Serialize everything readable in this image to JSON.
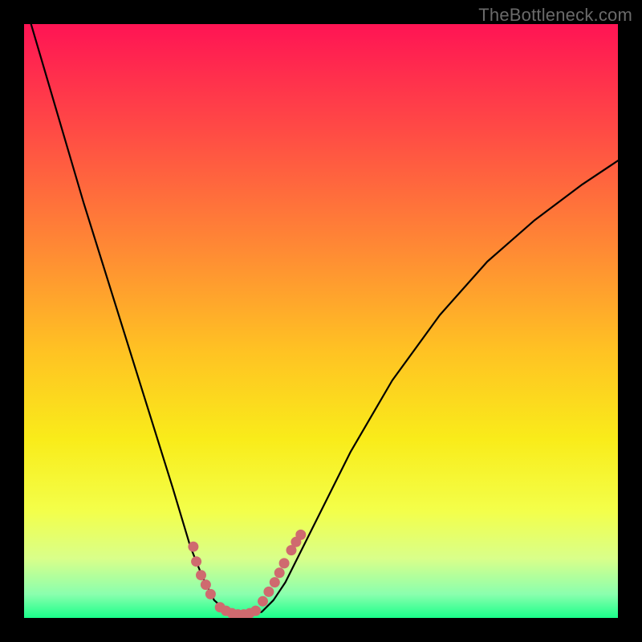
{
  "watermark": "TheBottleneck.com",
  "chart_data": {
    "type": "line",
    "title": "",
    "xlabel": "",
    "ylabel": "",
    "xlim": [
      0,
      100
    ],
    "ylim": [
      0,
      100
    ],
    "series": [
      {
        "name": "bottleneck-curve",
        "x": [
          0,
          5,
          10,
          15,
          20,
          25,
          28,
          30,
          32,
          34,
          36,
          38,
          40,
          42,
          44,
          48,
          55,
          62,
          70,
          78,
          86,
          94,
          100
        ],
        "y": [
          104,
          87,
          70,
          54,
          38,
          22,
          12,
          7,
          3,
          1.2,
          0.5,
          0.5,
          1.0,
          3,
          6,
          14,
          28,
          40,
          51,
          60,
          67,
          73,
          77
        ]
      }
    ],
    "highlight_segments": [
      {
        "x": [
          28.5,
          29.0,
          29.8,
          30.6,
          31.4
        ],
        "y": [
          12.0,
          9.5,
          7.2,
          5.6,
          4.0
        ],
        "color": "#cf6a6f"
      },
      {
        "x": [
          33.0,
          34.0,
          35.0,
          36.0,
          37.0,
          38.0,
          39.0
        ],
        "y": [
          1.8,
          1.2,
          0.8,
          0.6,
          0.6,
          0.8,
          1.2
        ],
        "color": "#cf6a6f"
      },
      {
        "x": [
          40.2,
          41.2,
          42.2,
          43.0,
          43.8
        ],
        "y": [
          2.8,
          4.4,
          6.0,
          7.6,
          9.2
        ],
        "color": "#cf6a6f"
      },
      {
        "x": [
          45.0,
          45.8,
          46.6
        ],
        "y": [
          11.4,
          12.8,
          14.0
        ],
        "color": "#cf6a6f"
      }
    ],
    "gradient_stops": [
      {
        "offset": 0.0,
        "color": "#ff1454"
      },
      {
        "offset": 0.18,
        "color": "#ff4b45"
      },
      {
        "offset": 0.38,
        "color": "#ff8a34"
      },
      {
        "offset": 0.55,
        "color": "#ffc223"
      },
      {
        "offset": 0.7,
        "color": "#f9ec1a"
      },
      {
        "offset": 0.82,
        "color": "#f3ff4a"
      },
      {
        "offset": 0.9,
        "color": "#d9ff8a"
      },
      {
        "offset": 0.96,
        "color": "#8affae"
      },
      {
        "offset": 1.0,
        "color": "#1aff8a"
      }
    ]
  }
}
